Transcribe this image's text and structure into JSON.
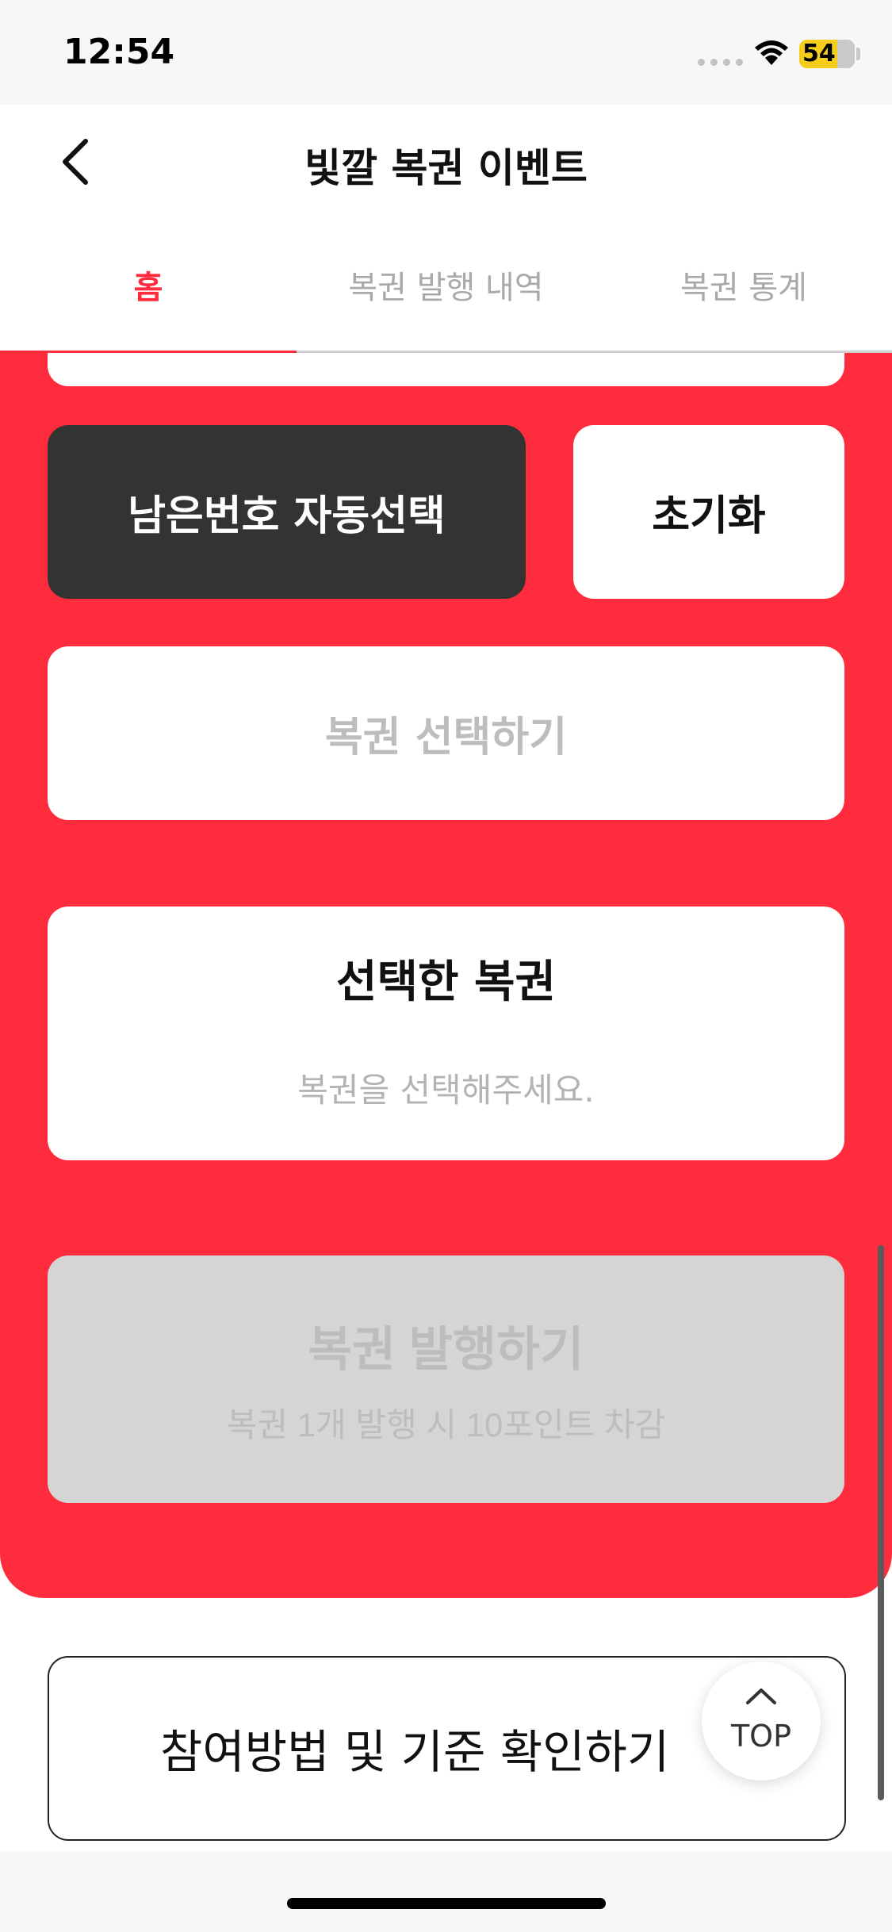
{
  "status_bar": {
    "time": "12:54",
    "battery": "54"
  },
  "header": {
    "title": "빛깔 복권 이벤트"
  },
  "tabs": [
    {
      "label": "홈",
      "active": true
    },
    {
      "label": "복권 발행 내역",
      "active": false
    },
    {
      "label": "복권 통계",
      "active": false
    }
  ],
  "actions": {
    "auto_select": "남은번호 자동선택",
    "reset": "초기화",
    "select": "복권 선택하기"
  },
  "selected": {
    "title": "선택한 복권",
    "empty": "복권을 선택해주세요."
  },
  "issue": {
    "label": "복권 발행하기",
    "sub": "복권 1개 발행 시 10포인트 차감"
  },
  "howto": {
    "label": "참여방법 및 기준 확인하기"
  },
  "top_button": {
    "label": "TOP"
  },
  "colors": {
    "accent": "#ff2c3e",
    "dark_button": "#333333",
    "disabled": "#d5d5d5"
  }
}
